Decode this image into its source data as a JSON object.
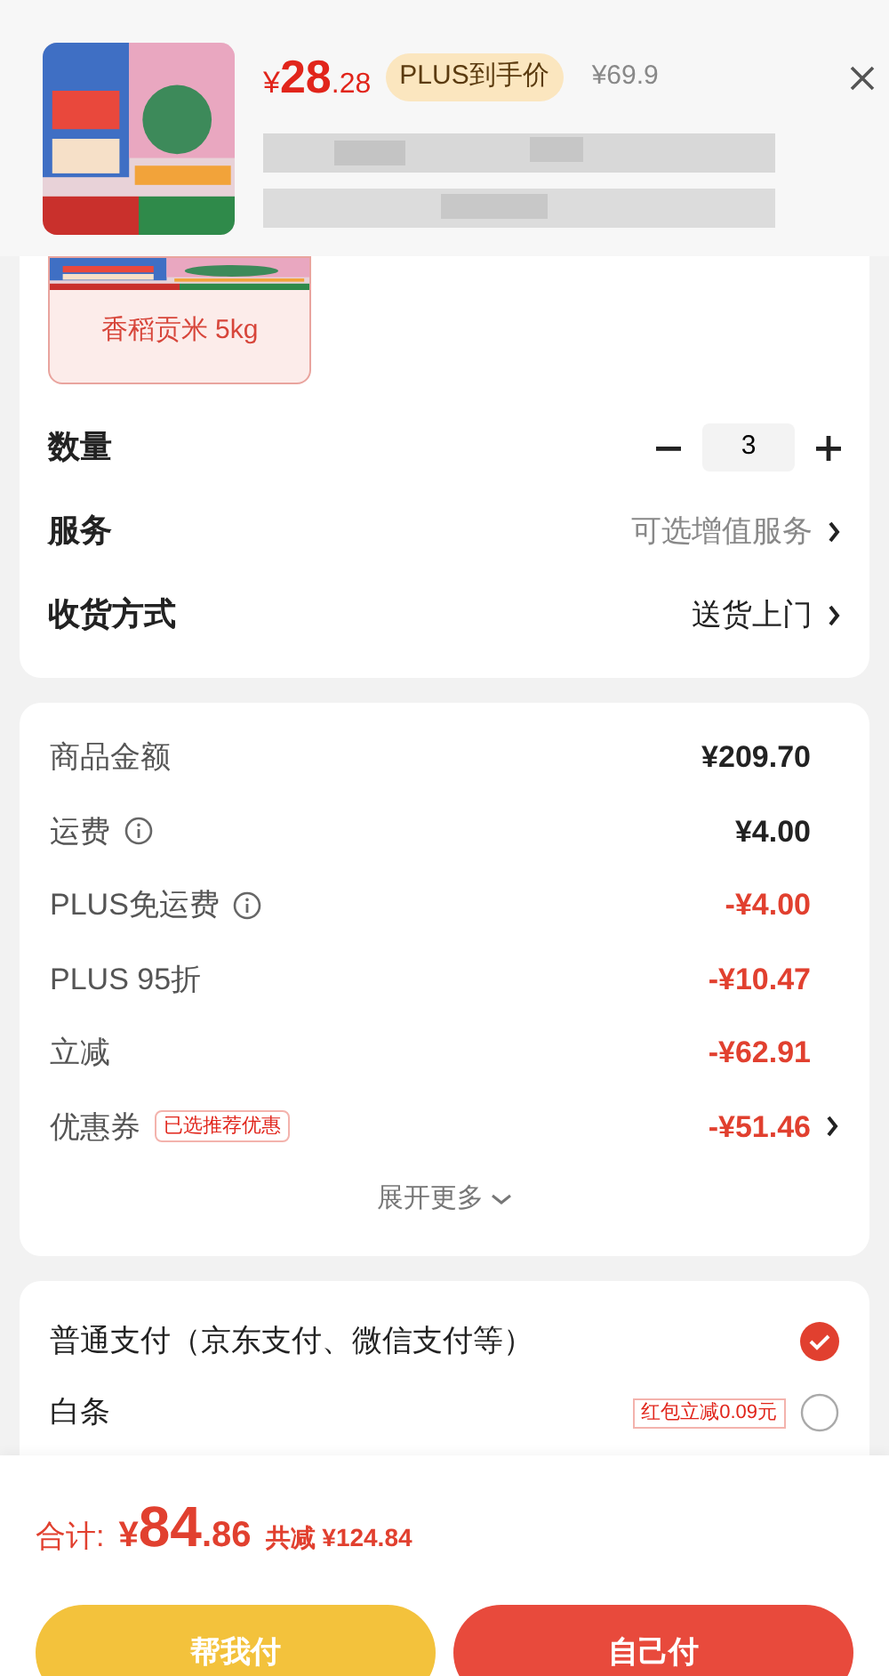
{
  "header": {
    "price_symbol": "¥",
    "price_int": "28",
    "price_dec": ".28",
    "plus_badge": "PLUS到手价",
    "original_price": "¥69.9"
  },
  "variant": {
    "label": "香稻贡米 5kg",
    "selected": true
  },
  "options": [
    {
      "kind": "quantity",
      "label": "数量",
      "value": "3"
    },
    {
      "kind": "link",
      "label": "服务",
      "value": "可选增值服务",
      "muted": true
    },
    {
      "kind": "link",
      "label": "收货方式",
      "value": "送货上门",
      "muted": false
    }
  ],
  "costs": [
    {
      "label": "商品金额",
      "value": "¥209.70",
      "discount": false,
      "info": false
    },
    {
      "label": "运费",
      "value": "¥4.00",
      "discount": false,
      "info": true
    },
    {
      "label": "PLUS免运费",
      "value": "-¥4.00",
      "discount": true,
      "info": true
    },
    {
      "label": "PLUS 95折",
      "value": "-¥10.47",
      "discount": true,
      "info": false
    },
    {
      "label": "立减",
      "value": "-¥62.91",
      "discount": true,
      "info": false
    },
    {
      "label": "优惠券",
      "tag": "已选推荐优惠",
      "value": "-¥51.46",
      "discount": true,
      "info": false,
      "link": true
    }
  ],
  "expand": "展开更多",
  "payments": [
    {
      "label": "普通支付（京东支付、微信支付等）",
      "selected": true
    },
    {
      "label": "白条",
      "tag": "红包立减0.09元",
      "selected": false
    }
  ],
  "footer": {
    "total_label": "合计:",
    "total_symbol": "¥",
    "total_int": "84",
    "total_dec": ".86",
    "saved": "共减 ¥124.84",
    "buttons": [
      {
        "label": "帮我付",
        "kind": "secondary"
      },
      {
        "label": "自己付",
        "kind": "primary"
      }
    ]
  }
}
